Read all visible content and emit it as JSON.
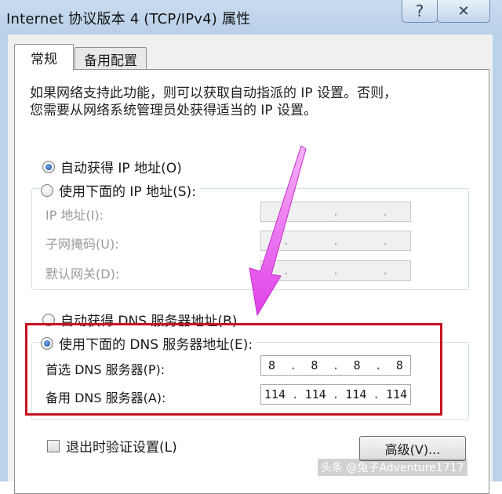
{
  "window": {
    "title": "Internet 协议版本 4 (TCP/IPv4) 属性",
    "help_btn": "?",
    "close_btn": "✕"
  },
  "tabs": [
    {
      "label": "常规",
      "active": true
    },
    {
      "label": "备用配置",
      "active": false
    }
  ],
  "description": {
    "line1": "如果网络支持此功能，则可以获取自动指派的 IP 设置。否则，",
    "line2": "您需要从网络系统管理员处获得适当的 IP 设置。"
  },
  "ip_section": {
    "auto_label": "自动获得 IP 地址(O)",
    "manual_label": "使用下面的 IP 地址(S):",
    "auto_selected": true,
    "fields": [
      {
        "label": "IP 地址(I):",
        "value": [
          ".",
          ".",
          "."
        ]
      },
      {
        "label": "子网掩码(U):",
        "value": [
          ".",
          ".",
          "."
        ]
      },
      {
        "label": "默认网关(D):",
        "value": [
          ".",
          ".",
          "."
        ]
      }
    ]
  },
  "dns_section": {
    "auto_label": "自动获得 DNS 服务器地址(B)",
    "manual_label": "使用下面的 DNS 服务器地址(E):",
    "manual_selected": true,
    "preferred_label": "首选 DNS 服务器(P):",
    "preferred_octets": [
      "8",
      "8",
      "8",
      "8"
    ],
    "alternate_label": "备用 DNS 服务器(A):",
    "alternate_octets": [
      "114",
      "114",
      "114",
      "114"
    ]
  },
  "footer": {
    "validate_label": "退出时验证设置(L)",
    "advanced_btn": "高级(V)..."
  },
  "watermark": "头条 @兔子Adventure1717",
  "colors": {
    "highlight": "#c4141f",
    "arrow": "#e040e8"
  },
  "icons": {
    "arrow": "magenta-arrow-icon"
  }
}
